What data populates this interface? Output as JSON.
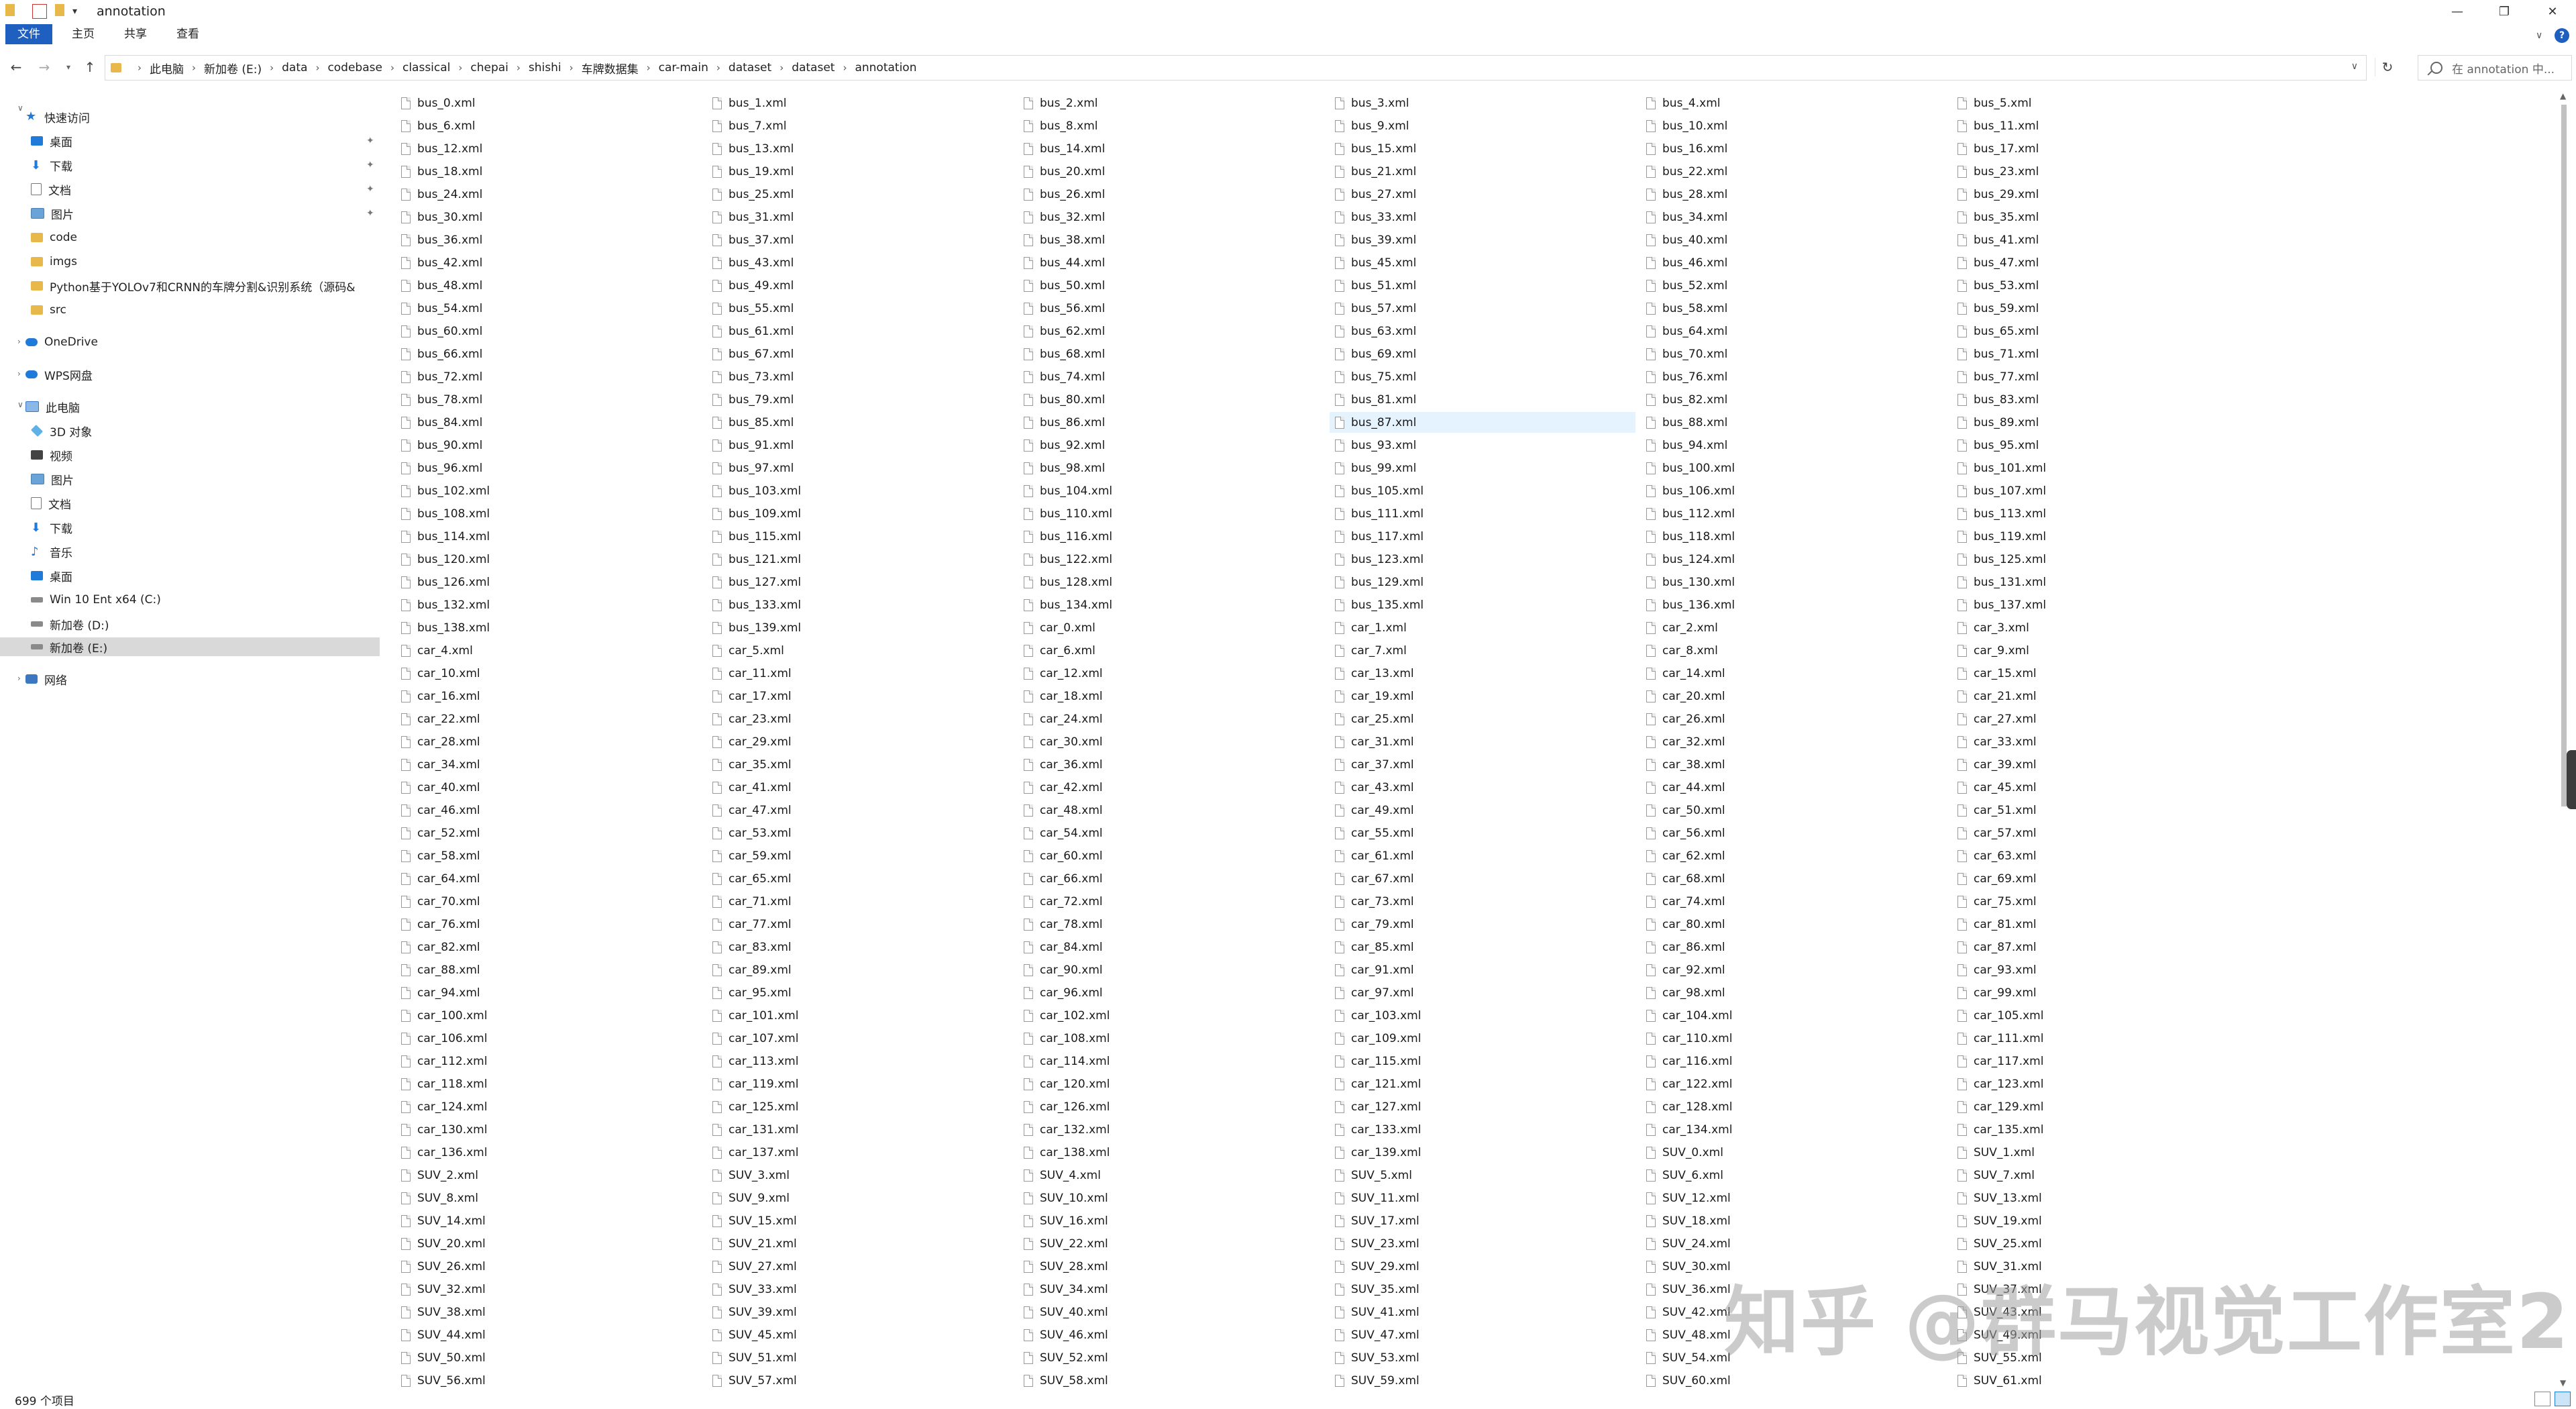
{
  "window": {
    "title": "annotation",
    "controls": [
      "minimize",
      "maximize",
      "close"
    ]
  },
  "ribbon": {
    "tabs": [
      {
        "label": "文件"
      },
      {
        "label": "主页"
      },
      {
        "label": "共享"
      },
      {
        "label": "查看"
      }
    ]
  },
  "address": {
    "breadcrumb": [
      "此电脑",
      "新加卷 (E:)",
      "data",
      "codebase",
      "classical",
      "chepai",
      "shishi",
      "车牌数据集",
      "car-main",
      "dataset",
      "dataset",
      "annotation"
    ],
    "search_placeholder": "在 annotation 中..."
  },
  "sidebar": {
    "items": [
      {
        "label": "快速访问",
        "icon": "star-icon"
      },
      {
        "label": "桌面",
        "icon": "desktop-icon",
        "pinned": true
      },
      {
        "label": "下载",
        "icon": "download-icon",
        "pinned": true
      },
      {
        "label": "文档",
        "icon": "document-icon",
        "pinned": true
      },
      {
        "label": "图片",
        "icon": "picture-icon",
        "pinned": true
      },
      {
        "label": "code",
        "icon": "folder-icon"
      },
      {
        "label": "imgs",
        "icon": "folder-icon"
      },
      {
        "label": "Python基于YOLOv7和CRNN的车牌分割&识别系统（源码&",
        "icon": "folder-icon"
      },
      {
        "label": "src",
        "icon": "folder-icon"
      },
      {
        "label": "OneDrive",
        "icon": "cloud-icon"
      },
      {
        "label": "WPS网盘",
        "icon": "cloud-icon"
      },
      {
        "label": "此电脑",
        "icon": "computer-icon"
      },
      {
        "label": "3D 对象",
        "icon": "3d-objects-icon"
      },
      {
        "label": "视频",
        "icon": "video-icon"
      },
      {
        "label": "图片",
        "icon": "picture-icon"
      },
      {
        "label": "文档",
        "icon": "document-icon"
      },
      {
        "label": "下载",
        "icon": "download-icon"
      },
      {
        "label": "音乐",
        "icon": "music-icon"
      },
      {
        "label": "桌面",
        "icon": "desktop-icon"
      },
      {
        "label": "Win 10 Ent x64 (C:)",
        "icon": "drive-icon"
      },
      {
        "label": "新加卷 (D:)",
        "icon": "drive-icon"
      },
      {
        "label": "新加卷 (E:)",
        "icon": "drive-icon",
        "selected": true
      },
      {
        "label": "网络",
        "icon": "network-icon"
      }
    ]
  },
  "files": [
    "bus_0.xml",
    "bus_1.xml",
    "bus_2.xml",
    "bus_3.xml",
    "bus_4.xml",
    "bus_5.xml",
    "bus_6.xml",
    "bus_7.xml",
    "bus_8.xml",
    "bus_9.xml",
    "bus_10.xml",
    "bus_11.xml",
    "bus_12.xml",
    "bus_13.xml",
    "bus_14.xml",
    "bus_15.xml",
    "bus_16.xml",
    "bus_17.xml",
    "bus_18.xml",
    "bus_19.xml",
    "bus_20.xml",
    "bus_21.xml",
    "bus_22.xml",
    "bus_23.xml",
    "bus_24.xml",
    "bus_25.xml",
    "bus_26.xml",
    "bus_27.xml",
    "bus_28.xml",
    "bus_29.xml",
    "bus_30.xml",
    "bus_31.xml",
    "bus_32.xml",
    "bus_33.xml",
    "bus_34.xml",
    "bus_35.xml",
    "bus_36.xml",
    "bus_37.xml",
    "bus_38.xml",
    "bus_39.xml",
    "bus_40.xml",
    "bus_41.xml",
    "bus_42.xml",
    "bus_43.xml",
    "bus_44.xml",
    "bus_45.xml",
    "bus_46.xml",
    "bus_47.xml",
    "bus_48.xml",
    "bus_49.xml",
    "bus_50.xml",
    "bus_51.xml",
    "bus_52.xml",
    "bus_53.xml",
    "bus_54.xml",
    "bus_55.xml",
    "bus_56.xml",
    "bus_57.xml",
    "bus_58.xml",
    "bus_59.xml",
    "bus_60.xml",
    "bus_61.xml",
    "bus_62.xml",
    "bus_63.xml",
    "bus_64.xml",
    "bus_65.xml",
    "bus_66.xml",
    "bus_67.xml",
    "bus_68.xml",
    "bus_69.xml",
    "bus_70.xml",
    "bus_71.xml",
    "bus_72.xml",
    "bus_73.xml",
    "bus_74.xml",
    "bus_75.xml",
    "bus_76.xml",
    "bus_77.xml",
    "bus_78.xml",
    "bus_79.xml",
    "bus_80.xml",
    "bus_81.xml",
    "bus_82.xml",
    "bus_83.xml",
    "bus_84.xml",
    "bus_85.xml",
    "bus_86.xml",
    "bus_87.xml",
    "bus_88.xml",
    "bus_89.xml",
    "bus_90.xml",
    "bus_91.xml",
    "bus_92.xml",
    "bus_93.xml",
    "bus_94.xml",
    "bus_95.xml",
    "bus_96.xml",
    "bus_97.xml",
    "bus_98.xml",
    "bus_99.xml",
    "bus_100.xml",
    "bus_101.xml",
    "bus_102.xml",
    "bus_103.xml",
    "bus_104.xml",
    "bus_105.xml",
    "bus_106.xml",
    "bus_107.xml",
    "bus_108.xml",
    "bus_109.xml",
    "bus_110.xml",
    "bus_111.xml",
    "bus_112.xml",
    "bus_113.xml",
    "bus_114.xml",
    "bus_115.xml",
    "bus_116.xml",
    "bus_117.xml",
    "bus_118.xml",
    "bus_119.xml",
    "bus_120.xml",
    "bus_121.xml",
    "bus_122.xml",
    "bus_123.xml",
    "bus_124.xml",
    "bus_125.xml",
    "bus_126.xml",
    "bus_127.xml",
    "bus_128.xml",
    "bus_129.xml",
    "bus_130.xml",
    "bus_131.xml",
    "bus_132.xml",
    "bus_133.xml",
    "bus_134.xml",
    "bus_135.xml",
    "bus_136.xml",
    "bus_137.xml",
    "bus_138.xml",
    "bus_139.xml",
    "car_0.xml",
    "car_1.xml",
    "car_2.xml",
    "car_3.xml",
    "car_4.xml",
    "car_5.xml",
    "car_6.xml",
    "car_7.xml",
    "car_8.xml",
    "car_9.xml",
    "car_10.xml",
    "car_11.xml",
    "car_12.xml",
    "car_13.xml",
    "car_14.xml",
    "car_15.xml",
    "car_16.xml",
    "car_17.xml",
    "car_18.xml",
    "car_19.xml",
    "car_20.xml",
    "car_21.xml",
    "car_22.xml",
    "car_23.xml",
    "car_24.xml",
    "car_25.xml",
    "car_26.xml",
    "car_27.xml",
    "car_28.xml",
    "car_29.xml",
    "car_30.xml",
    "car_31.xml",
    "car_32.xml",
    "car_33.xml",
    "car_34.xml",
    "car_35.xml",
    "car_36.xml",
    "car_37.xml",
    "car_38.xml",
    "car_39.xml",
    "car_40.xml",
    "car_41.xml",
    "car_42.xml",
    "car_43.xml",
    "car_44.xml",
    "car_45.xml",
    "car_46.xml",
    "car_47.xml",
    "car_48.xml",
    "car_49.xml",
    "car_50.xml",
    "car_51.xml",
    "car_52.xml",
    "car_53.xml",
    "car_54.xml",
    "car_55.xml",
    "car_56.xml",
    "car_57.xml",
    "car_58.xml",
    "car_59.xml",
    "car_60.xml",
    "car_61.xml",
    "car_62.xml",
    "car_63.xml",
    "car_64.xml",
    "car_65.xml",
    "car_66.xml",
    "car_67.xml",
    "car_68.xml",
    "car_69.xml",
    "car_70.xml",
    "car_71.xml",
    "car_72.xml",
    "car_73.xml",
    "car_74.xml",
    "car_75.xml",
    "car_76.xml",
    "car_77.xml",
    "car_78.xml",
    "car_79.xml",
    "car_80.xml",
    "car_81.xml",
    "car_82.xml",
    "car_83.xml",
    "car_84.xml",
    "car_85.xml",
    "car_86.xml",
    "car_87.xml",
    "car_88.xml",
    "car_89.xml",
    "car_90.xml",
    "car_91.xml",
    "car_92.xml",
    "car_93.xml",
    "car_94.xml",
    "car_95.xml",
    "car_96.xml",
    "car_97.xml",
    "car_98.xml",
    "car_99.xml",
    "car_100.xml",
    "car_101.xml",
    "car_102.xml",
    "car_103.xml",
    "car_104.xml",
    "car_105.xml",
    "car_106.xml",
    "car_107.xml",
    "car_108.xml",
    "car_109.xml",
    "car_110.xml",
    "car_111.xml",
    "car_112.xml",
    "car_113.xml",
    "car_114.xml",
    "car_115.xml",
    "car_116.xml",
    "car_117.xml",
    "car_118.xml",
    "car_119.xml",
    "car_120.xml",
    "car_121.xml",
    "car_122.xml",
    "car_123.xml",
    "car_124.xml",
    "car_125.xml",
    "car_126.xml",
    "car_127.xml",
    "car_128.xml",
    "car_129.xml",
    "car_130.xml",
    "car_131.xml",
    "car_132.xml",
    "car_133.xml",
    "car_134.xml",
    "car_135.xml",
    "car_136.xml",
    "car_137.xml",
    "car_138.xml",
    "car_139.xml",
    "SUV_0.xml",
    "SUV_1.xml",
    "SUV_2.xml",
    "SUV_3.xml",
    "SUV_4.xml",
    "SUV_5.xml",
    "SUV_6.xml",
    "SUV_7.xml",
    "SUV_8.xml",
    "SUV_9.xml",
    "SUV_10.xml",
    "SUV_11.xml",
    "SUV_12.xml",
    "SUV_13.xml",
    "SUV_14.xml",
    "SUV_15.xml",
    "SUV_16.xml",
    "SUV_17.xml",
    "SUV_18.xml",
    "SUV_19.xml",
    "SUV_20.xml",
    "SUV_21.xml",
    "SUV_22.xml",
    "SUV_23.xml",
    "SUV_24.xml",
    "SUV_25.xml",
    "SUV_26.xml",
    "SUV_27.xml",
    "SUV_28.xml",
    "SUV_29.xml",
    "SUV_30.xml",
    "SUV_31.xml",
    "SUV_32.xml",
    "SUV_33.xml",
    "SUV_34.xml",
    "SUV_35.xml",
    "SUV_36.xml",
    "SUV_37.xml",
    "SUV_38.xml",
    "SUV_39.xml",
    "SUV_40.xml",
    "SUV_41.xml",
    "SUV_42.xml",
    "SUV_43.xml",
    "SUV_44.xml",
    "SUV_45.xml",
    "SUV_46.xml",
    "SUV_47.xml",
    "SUV_48.xml",
    "SUV_49.xml",
    "SUV_50.xml",
    "SUV_51.xml",
    "SUV_52.xml",
    "SUV_53.xml",
    "SUV_54.xml",
    "SUV_55.xml",
    "SUV_56.xml",
    "SUV_57.xml",
    "SUV_58.xml",
    "SUV_59.xml",
    "SUV_60.xml",
    "SUV_61.xml"
  ],
  "highlighted_file": "bus_87.xml",
  "status": {
    "item_count": "699 个项目"
  },
  "watermark": "知乎 @群马视觉工作室2",
  "colors": {
    "accent": "#1f5fbf",
    "selection": "#cce4f7",
    "hover": "#e5f3ff",
    "folder": "#e8b84a"
  }
}
